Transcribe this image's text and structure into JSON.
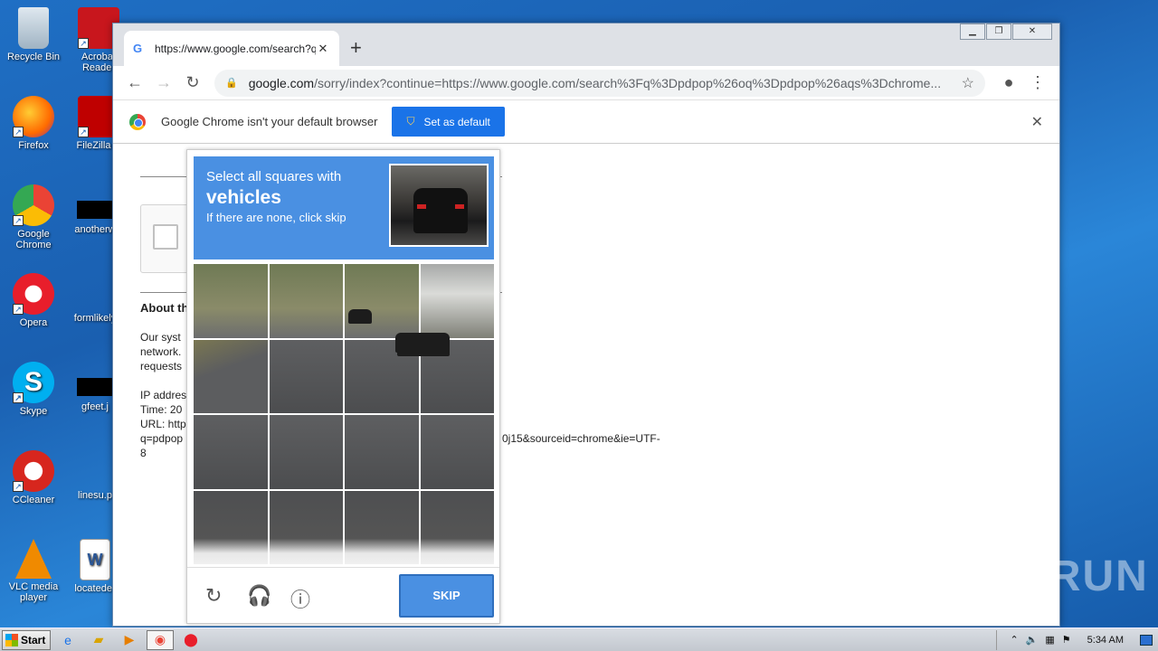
{
  "desktop": {
    "icons": [
      {
        "label": "Recycle Bin",
        "icon": "recycle-bin-icon"
      },
      {
        "label": "Acrobat Reader",
        "icon": "acrobat-icon"
      },
      {
        "label": "Firefox",
        "icon": "firefox-icon"
      },
      {
        "label": "FileZilla C",
        "icon": "filezilla-icon"
      },
      {
        "label": "Google Chrome",
        "icon": "chrome-icon"
      },
      {
        "label": "anotherw",
        "icon": "file-icon"
      },
      {
        "label": "Opera",
        "icon": "opera-icon"
      },
      {
        "label": "formlikely",
        "icon": "file-icon"
      },
      {
        "label": "Skype",
        "icon": "skype-icon"
      },
      {
        "label": "gfeet.j",
        "icon": "file-icon"
      },
      {
        "label": "CCleaner",
        "icon": "ccleaner-icon"
      },
      {
        "label": "linesu.p",
        "icon": "file-icon"
      },
      {
        "label": "VLC media player",
        "icon": "vlc-icon"
      },
      {
        "label": "locateder",
        "icon": "word-icon"
      }
    ]
  },
  "browser": {
    "tab_title": "https://www.google.com/search?q=",
    "address": {
      "host": "google.com",
      "rest": "/sorry/index?continue=https://www.google.com/search%3Fq%3Dpdpop%26oq%3Dpdpop%26aqs%3Dchrome..."
    },
    "infobar": {
      "message": "Google Chrome isn't your default browser",
      "button": "Set as default"
    }
  },
  "page": {
    "about": "About th",
    "para": [
      "Our syst",
      "network.",
      "requests"
    ],
    "meta": [
      "IP addres",
      "Time: 20",
      "URL: http",
      "q=pdpop"
    ],
    "url_tail": "0j15&sourceid=chrome&ie=UTF-",
    "url_tail2": "8"
  },
  "captcha": {
    "line1": "Select all squares with",
    "target": "vehicles",
    "line3": "If there are none, click skip",
    "skip_label": "SKIP"
  },
  "taskbar": {
    "start_label": "Start",
    "clock": "5:34 AM"
  },
  "watermark": "ANY RUN"
}
